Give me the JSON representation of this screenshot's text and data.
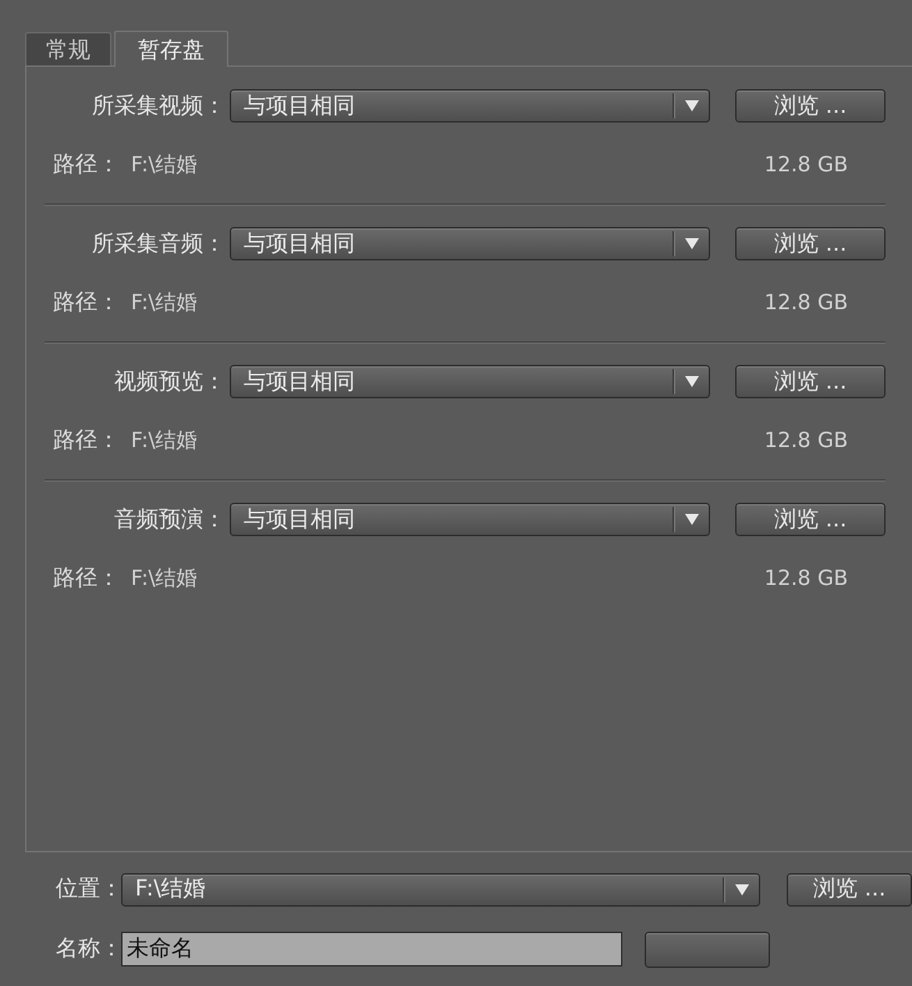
{
  "tabs": [
    {
      "label": "常规",
      "selected": false
    },
    {
      "label": "暂存盘",
      "selected": true
    }
  ],
  "scratch_disks": [
    {
      "label": "所采集视频：",
      "dropdown": {
        "value": "与项目相同"
      },
      "browse_button": "浏览 ...",
      "path_label": "路径：",
      "path": "F:\\结婚",
      "free_space": "12.8 GB"
    },
    {
      "label": "所采集音频：",
      "dropdown": {
        "value": "与项目相同"
      },
      "browse_button": "浏览 ...",
      "path_label": "路径：",
      "path": "F:\\结婚",
      "free_space": "12.8 GB"
    },
    {
      "label": "视频预览：",
      "dropdown": {
        "value": "与项目相同"
      },
      "browse_button": "浏览 ...",
      "path_label": "路径：",
      "path": "F:\\结婚",
      "free_space": "12.8 GB"
    },
    {
      "label": "音频预演：",
      "dropdown": {
        "value": "与项目相同"
      },
      "browse_button": "浏览 ...",
      "path_label": "路径：",
      "path": "F:\\结婚",
      "free_space": "12.8 GB"
    }
  ],
  "location": {
    "label": "位置：",
    "dropdown": {
      "value": "F:\\结婚"
    },
    "browse_button": "浏览 ..."
  },
  "name": {
    "label": "名称：",
    "value": "未命名"
  }
}
